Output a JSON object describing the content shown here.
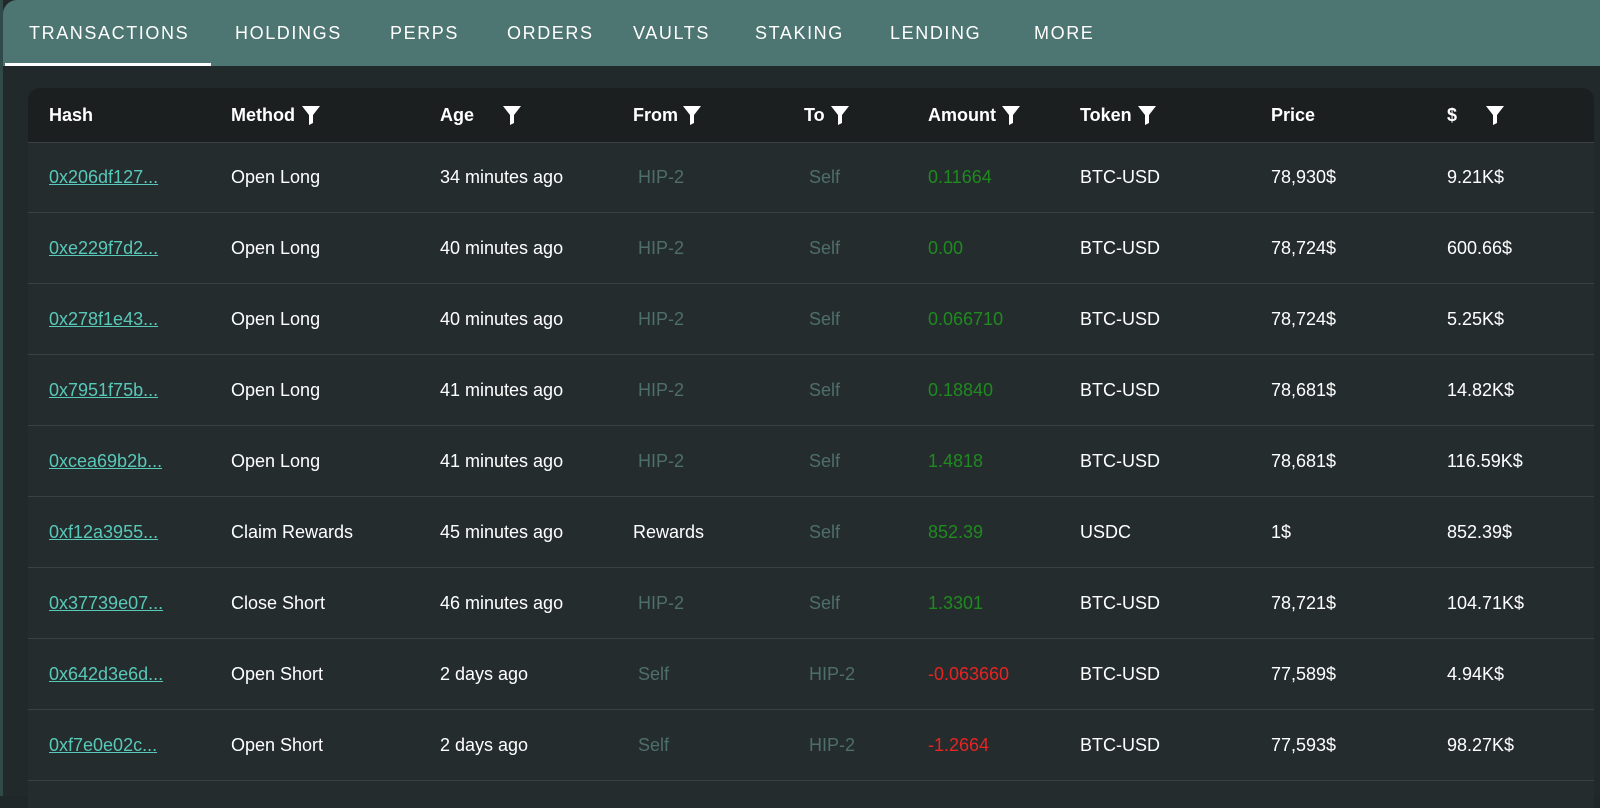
{
  "tabs": [
    {
      "label": "TRANSACTIONS",
      "active": true
    },
    {
      "label": "HOLDINGS",
      "active": false
    },
    {
      "label": "PERPS",
      "active": false
    },
    {
      "label": "ORDERS",
      "active": false
    },
    {
      "label": "VAULTS",
      "active": false
    },
    {
      "label": "STAKING",
      "active": false
    },
    {
      "label": "LENDING",
      "active": false
    },
    {
      "label": "MORE",
      "active": false
    }
  ],
  "table": {
    "columns": [
      {
        "label": "Hash",
        "filter": false
      },
      {
        "label": "Method",
        "filter": true
      },
      {
        "label": "Age",
        "filter": true
      },
      {
        "label": "From",
        "filter": true
      },
      {
        "label": "To",
        "filter": true
      },
      {
        "label": "Amount",
        "filter": true
      },
      {
        "label": "Token",
        "filter": true
      },
      {
        "label": "Price",
        "filter": false
      },
      {
        "label": "$",
        "filter": true
      }
    ],
    "rows": [
      {
        "hash": "0x206df127...",
        "method": "Open Long",
        "age": "34 minutes ago",
        "from": "HIP-2",
        "to": "Self",
        "amount": "0.11664",
        "token": "BTC-USD",
        "price": "78,930$",
        "usd": "9.21K$"
      },
      {
        "hash": "0xe229f7d2...",
        "method": "Open Long",
        "age": "40 minutes ago",
        "from": "HIP-2",
        "to": "Self",
        "amount": "0.00",
        "token": "BTC-USD",
        "price": "78,724$",
        "usd": "600.66$"
      },
      {
        "hash": "0x278f1e43...",
        "method": "Open Long",
        "age": "40 minutes ago",
        "from": "HIP-2",
        "to": "Self",
        "amount": "0.066710",
        "token": "BTC-USD",
        "price": "78,724$",
        "usd": "5.25K$"
      },
      {
        "hash": "0x7951f75b...",
        "method": "Open Long",
        "age": "41 minutes ago",
        "from": "HIP-2",
        "to": "Self",
        "amount": "0.18840",
        "token": "BTC-USD",
        "price": "78,681$",
        "usd": "14.82K$"
      },
      {
        "hash": "0xcea69b2b...",
        "method": "Open Long",
        "age": "41 minutes ago",
        "from": "HIP-2",
        "to": "Self",
        "amount": "1.4818",
        "token": "BTC-USD",
        "price": "78,681$",
        "usd": "116.59K$"
      },
      {
        "hash": "0xf12a3955...",
        "method": "Claim Rewards",
        "age": "45 minutes ago",
        "from": "Rewards",
        "to": "Self",
        "amount": "852.39",
        "token": "USDC",
        "price": "1$",
        "usd": "852.39$"
      },
      {
        "hash": "0x37739e07...",
        "method": "Close Short",
        "age": "46 minutes ago",
        "from": "HIP-2",
        "to": "Self",
        "amount": "1.3301",
        "token": "BTC-USD",
        "price": "78,721$",
        "usd": "104.71K$"
      },
      {
        "hash": "0x642d3e6d...",
        "method": "Open Short",
        "age": "2 days ago",
        "from": "Self",
        "to": "HIP-2",
        "amount": "-0.063660",
        "token": "BTC-USD",
        "price": "77,589$",
        "usd": "4.94K$"
      },
      {
        "hash": "0xf7e0e02c...",
        "method": "Open Short",
        "age": "2 days ago",
        "from": "Self",
        "to": "HIP-2",
        "amount": "-1.2664",
        "token": "BTC-USD",
        "price": "77,593$",
        "usd": "98.27K$"
      }
    ]
  },
  "colors": {
    "tabbar": "#4d7571",
    "header": "#1b1f20",
    "body": "#252c2e",
    "link": "#58c8b9",
    "positive": "#1f8a1f",
    "negative": "#e52424",
    "muted": "#4e6e6c"
  }
}
